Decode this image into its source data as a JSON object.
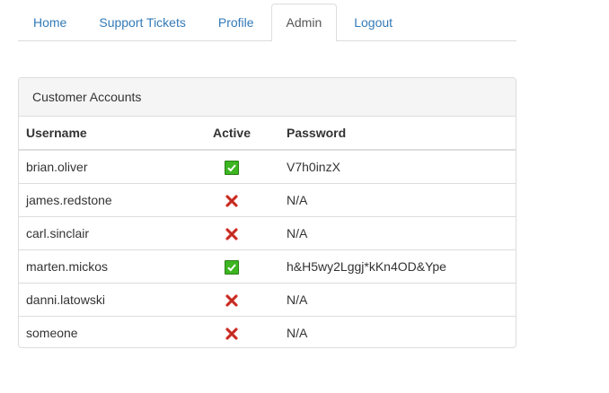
{
  "nav": {
    "tabs": [
      {
        "label": "Home",
        "active": false
      },
      {
        "label": "Support Tickets",
        "active": false
      },
      {
        "label": "Profile",
        "active": false
      },
      {
        "label": "Admin",
        "active": true
      },
      {
        "label": "Logout",
        "active": false
      }
    ]
  },
  "panel": {
    "title": "Customer Accounts",
    "columns": [
      "Username",
      "Active",
      "Password"
    ],
    "rows": [
      {
        "username": "brian.oliver",
        "active": true,
        "active_icon": "check-icon",
        "password": "V7h0inzX"
      },
      {
        "username": "james.redstone",
        "active": false,
        "active_icon": "cross-icon",
        "password": "N/A"
      },
      {
        "username": "carl.sinclair",
        "active": false,
        "active_icon": "cross-icon",
        "password": "N/A"
      },
      {
        "username": "marten.mickos",
        "active": true,
        "active_icon": "check-icon",
        "password": "h&H5wy2Lggj*kKn4OD&Ype"
      },
      {
        "username": "danni.latowski",
        "active": false,
        "active_icon": "cross-icon",
        "password": "N/A"
      },
      {
        "username": "someone",
        "active": false,
        "active_icon": "cross-icon",
        "password": "N/A"
      }
    ]
  },
  "colors": {
    "link": "#337ab7",
    "active_check": "#3cb521",
    "inactive_cross": "#d9342b"
  }
}
